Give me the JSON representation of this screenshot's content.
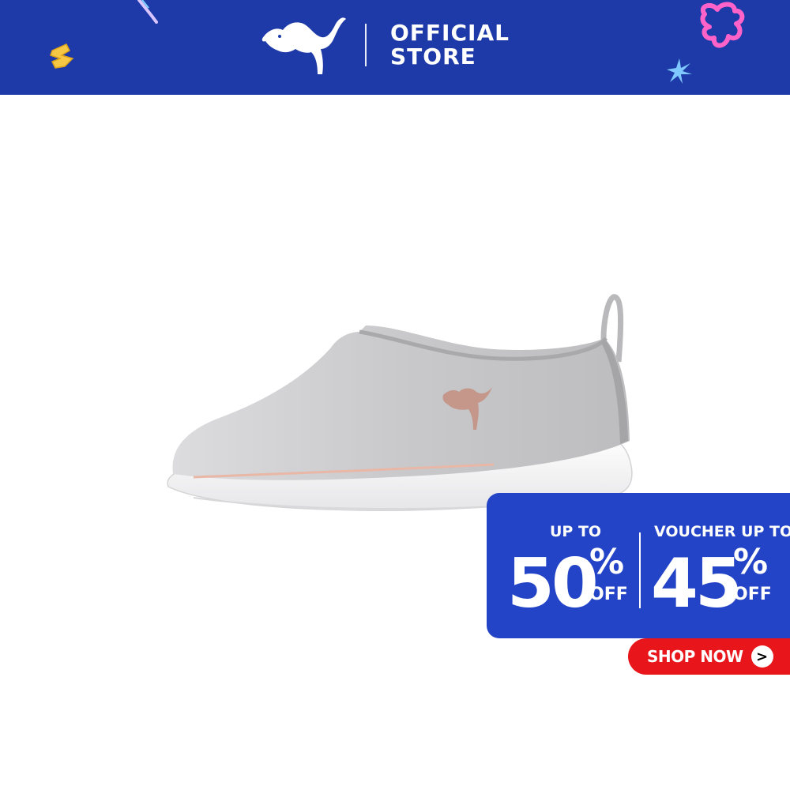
{
  "header": {
    "line1": "OFFICIAL",
    "line2": "STORE",
    "background": "#1e3aa8",
    "logo_icon": "puma-cat-logo-icon"
  },
  "product": {
    "icon": "grey-knit-slip-on-sneaker"
  },
  "promo": {
    "left_label": "UP TO",
    "left_value": "50",
    "left_percent": "%",
    "left_off": "OFF",
    "right_label": "VOUCHER UP TO",
    "right_value": "45",
    "right_percent": "%",
    "right_off": "OFF",
    "background": "#2344c6"
  },
  "cta": {
    "label": "SHOP NOW",
    "arrow": ">",
    "background": "#e8151b"
  }
}
